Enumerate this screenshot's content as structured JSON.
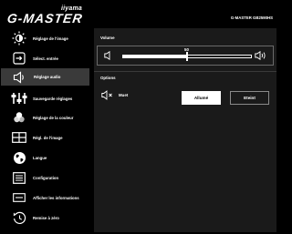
{
  "header": {
    "brand_small": "iiyama",
    "brand_big": "G-MASTER",
    "model": "G-MASTER GB2590HS"
  },
  "sidebar": {
    "items": [
      {
        "label": "Réglage de l'image",
        "icon": "brightness-icon"
      },
      {
        "label": "Sélect. entrée",
        "icon": "input-icon"
      },
      {
        "label": "Réglage audio",
        "icon": "speaker-icon",
        "active": true
      },
      {
        "label": "Sauvegarde réglages",
        "icon": "sliders-icon"
      },
      {
        "label": "Réglage de la couleur",
        "icon": "color-icon"
      },
      {
        "label": "Régl. de l'image",
        "icon": "layout-icon"
      },
      {
        "label": "Langue",
        "icon": "globe-icon"
      },
      {
        "label": "Configuration",
        "icon": "setup-icon"
      },
      {
        "label": "Afficher les informations",
        "icon": "info-icon"
      },
      {
        "label": "Remise à zéro",
        "icon": "reset-icon"
      }
    ]
  },
  "panel": {
    "volume_title": "Volume",
    "volume_value": "50",
    "volume_level": 0.5,
    "options_title": "Options",
    "mute_label": "Muet",
    "on_label": "Allumé",
    "off_label": "Eteint"
  },
  "colors": {
    "background": "#000000",
    "panel": "#1a1a1a",
    "active_item": "#3a3a3a",
    "accent": "#ffffff"
  }
}
